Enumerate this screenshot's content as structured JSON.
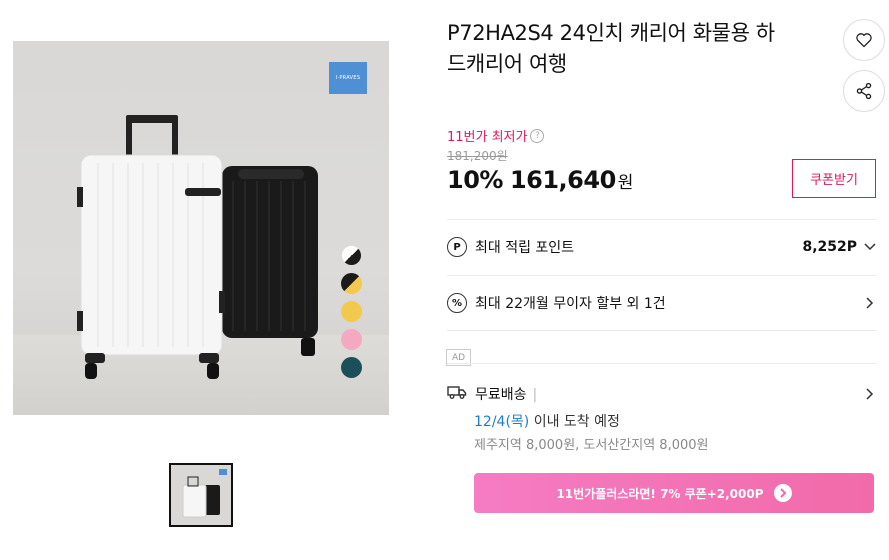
{
  "product": {
    "title_line1": "P72HA2S4 24인치 캐리어 화물용 하",
    "title_line2": "드캐리어 여행",
    "brand_logo_text": "I·PRAVES"
  },
  "price": {
    "lowest_label": "11번가 최저가",
    "help_glyph": "?",
    "original": "181,200원",
    "discount": "10%",
    "sale": "161,640",
    "currency": "원",
    "coupon_button": "쿠폰받기"
  },
  "benefits": {
    "points_label": "최대 적립 포인트",
    "points_value": "8,252P",
    "installment_label": "최대 22개월 무이자 할부 외 1건"
  },
  "ad_badge": "AD",
  "shipping": {
    "label": "무료배송",
    "separator": "|",
    "arrival_date": "12/4(목)",
    "arrival_text": " 이내 도착 예정",
    "extra_fee": "제주지역 8,000원, 도서산간지역 8,000원"
  },
  "promo_button": "11번가플러스라면! 7% 쿠폰+2,000P",
  "swatch_colors": [
    "#1b1b1b",
    "#1b1b1b",
    "#f2c94c",
    "#f4a9c0",
    "#1d4f5a"
  ],
  "icons": [
    "heart-icon",
    "share-icon",
    "point-icon",
    "percent-icon",
    "truck-icon",
    "chevron-right-icon",
    "chevron-down-icon"
  ]
}
